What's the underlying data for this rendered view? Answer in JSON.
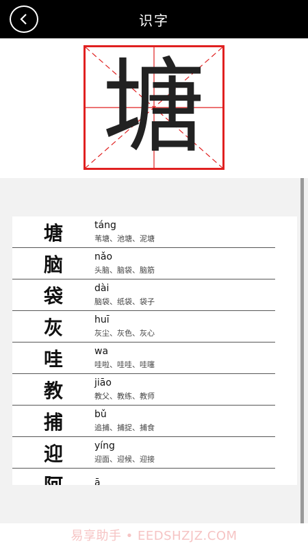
{
  "header": {
    "title": "识字",
    "back_icon": "chevron-left-icon"
  },
  "focus_char": "塘",
  "list": [
    {
      "char": "塘",
      "pinyin": "táng",
      "words": "苇塘、池塘、泥塘"
    },
    {
      "char": "脑",
      "pinyin": "nǎo",
      "words": "头脑、脑袋、脑筋"
    },
    {
      "char": "袋",
      "pinyin": "dài",
      "words": "脑袋、纸袋、袋子"
    },
    {
      "char": "灰",
      "pinyin": "huī",
      "words": "灰尘、灰色、灰心"
    },
    {
      "char": "哇",
      "pinyin": "wa",
      "words": "哇啦、哇哇、哇噻"
    },
    {
      "char": "教",
      "pinyin": "jiāo",
      "words": "教父、教练、教师"
    },
    {
      "char": "捕",
      "pinyin": "bǔ",
      "words": "追捕、捕捉、捕食"
    },
    {
      "char": "迎",
      "pinyin": "yíng",
      "words": "迎面、迎候、迎接"
    },
    {
      "char": "阿",
      "pinyin": "ā",
      "words": ""
    }
  ],
  "watermark": "易享助手 • EEDSHZJZ.COM",
  "colors": {
    "header_bg": "#000000",
    "grid_red": "#e02020"
  }
}
